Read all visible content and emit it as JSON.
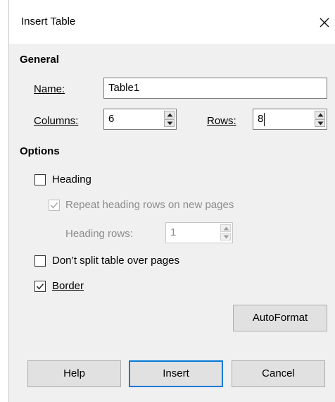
{
  "window": {
    "title": "Insert Table",
    "close_icon": "close-icon"
  },
  "general": {
    "section_label": "General",
    "name_label": "Name:",
    "name_value": "Table1",
    "columns_label": "Columns:",
    "columns_value": "6",
    "rows_label": "Rows:",
    "rows_value": "8"
  },
  "options": {
    "section_label": "Options",
    "heading_label": "Heading",
    "heading_checked": false,
    "repeat_heading_label": "Repeat heading rows on new pages",
    "repeat_heading_checked": true,
    "heading_rows_label": "Heading rows:",
    "heading_rows_value": "1",
    "dont_split_label": "Don’t split table over pages",
    "dont_split_checked": false,
    "border_label": "Border",
    "border_checked": true
  },
  "buttons": {
    "autoformat": "AutoFormat",
    "help": "Help",
    "insert": "Insert",
    "cancel": "Cancel"
  },
  "colors": {
    "accent": "#0078d7",
    "dialog_bg": "#f0f0f0",
    "disabled_text": "#8c8c8c"
  }
}
